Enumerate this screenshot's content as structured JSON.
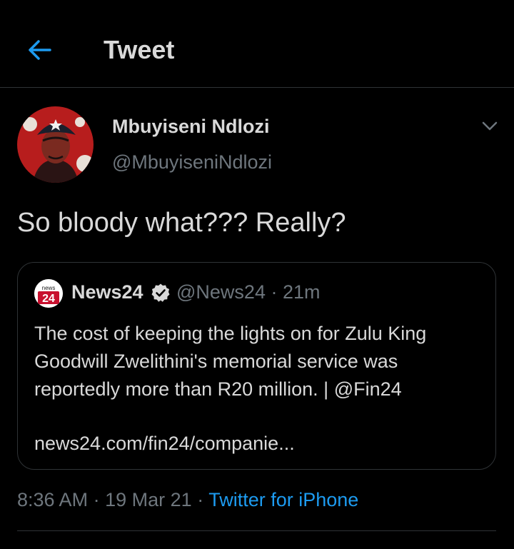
{
  "header": {
    "title": "Tweet",
    "back_icon": "arrow-left-icon"
  },
  "tweet": {
    "author_name": "Mbuyiseni Ndlozi",
    "author_handle": "@MbuyiseniNdlozi",
    "text": "So bloody what??? Really?",
    "menu_icon": "chevron-down-icon",
    "time": "8:36 AM",
    "date": "19 Mar 21",
    "separator": "·",
    "source": "Twitter for iPhone"
  },
  "quote": {
    "logo_small": "news",
    "logo_number": "24",
    "author_name": "News24",
    "verified_icon": "verified-badge-icon",
    "author_handle": "@News24",
    "elapsed": "21m",
    "text_lines": [
      "The cost of keeping the lights on for Zulu King",
      "Goodwill Zwelithini's memorial service was",
      "reportedly more than R20 million. | @Fin24"
    ],
    "link": "news24.com/fin24/companie..."
  },
  "colors": {
    "background": "#000000",
    "text": "#d9d9d9",
    "secondary": "#6e767d",
    "accent": "#1d9bf0",
    "border": "#2f3336"
  }
}
